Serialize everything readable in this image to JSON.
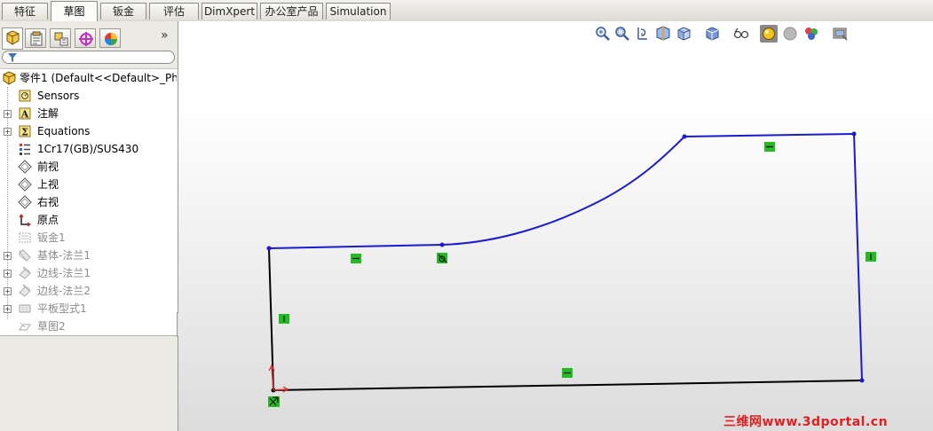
{
  "tabs": [
    {
      "label": "特征",
      "active": false
    },
    {
      "label": "草图",
      "active": true
    },
    {
      "label": "钣金",
      "active": false
    },
    {
      "label": "评估",
      "active": false
    },
    {
      "label": "DimXpert",
      "active": false
    },
    {
      "label": "办公室产品",
      "active": false
    },
    {
      "label": "Simulation",
      "active": false
    }
  ],
  "panel": {
    "tab_icons": [
      "feature-tree-icon",
      "property-manager-icon",
      "configuration-manager-icon",
      "dimxpert-manager-icon",
      "display-manager-icon"
    ],
    "more_label": "»",
    "filter_icon": "filter-icon"
  },
  "tree": {
    "root": {
      "label": "零件1  (Default<<Default>_Pho",
      "icon": "part-icon"
    },
    "items": [
      {
        "label": "Sensors",
        "icon": "sensor-icon",
        "expandable": false,
        "dimmed": false
      },
      {
        "label": "注解",
        "icon": "annotation-icon",
        "expandable": true,
        "dimmed": false
      },
      {
        "label": "Equations",
        "icon": "equation-icon",
        "expandable": true,
        "dimmed": false
      },
      {
        "label": "1Cr17(GB)/SUS430",
        "icon": "material-icon",
        "expandable": false,
        "dimmed": false
      },
      {
        "label": "前视",
        "icon": "plane-icon",
        "expandable": false,
        "dimmed": false
      },
      {
        "label": "上视",
        "icon": "plane-icon",
        "expandable": false,
        "dimmed": false
      },
      {
        "label": "右视",
        "icon": "plane-icon",
        "expandable": false,
        "dimmed": false
      },
      {
        "label": "原点",
        "icon": "origin-icon",
        "expandable": false,
        "dimmed": false
      },
      {
        "label": "钣金1",
        "icon": "sheetmetal-icon",
        "expandable": false,
        "dimmed": true
      },
      {
        "label": "基体-法兰1",
        "icon": "base-flange-icon",
        "expandable": true,
        "dimmed": true
      },
      {
        "label": "边线-法兰1",
        "icon": "edge-flange-icon",
        "expandable": true,
        "dimmed": true
      },
      {
        "label": "边线-法兰2",
        "icon": "edge-flange-icon",
        "expandable": true,
        "dimmed": true
      },
      {
        "label": "平板型式1",
        "icon": "flat-pattern-icon",
        "expandable": true,
        "dimmed": true
      },
      {
        "label": "草图2",
        "icon": "sketch-icon",
        "expandable": false,
        "dimmed": true
      }
    ]
  },
  "hud_toolbar": [
    {
      "icon": "zoom-to-fit-icon",
      "dropdown": false
    },
    {
      "icon": "zoom-to-area-icon",
      "dropdown": false
    },
    {
      "icon": "previous-view-icon",
      "dropdown": false
    },
    {
      "icon": "section-view-icon",
      "dropdown": false
    },
    {
      "icon": "view-orientation-icon",
      "dropdown": true
    },
    {
      "icon": "display-style-icon",
      "dropdown": true
    },
    {
      "icon": "hide-show-items-icon",
      "dropdown": true
    },
    {
      "icon": "edit-appearance-icon",
      "dropdown": false
    },
    {
      "icon": "apply-scene-icon",
      "dropdown": false
    },
    {
      "icon": "realview-icon",
      "dropdown": true
    },
    {
      "icon": "view-settings-icon",
      "dropdown": true
    }
  ],
  "sketch": {
    "line_color": "#1a1ad6",
    "fixed_color": "#000000",
    "relation_color": "#22bb22",
    "relation_icons": [
      "horizontal-relation-icon",
      "horizontal-relation-icon",
      "vertical-relation-icon",
      "vertical-relation-icon",
      "tangent-relation-icon",
      "horizontal-relation-icon",
      "fix-relation-icon"
    ]
  },
  "watermark": "三维网www.3dportal.cn"
}
